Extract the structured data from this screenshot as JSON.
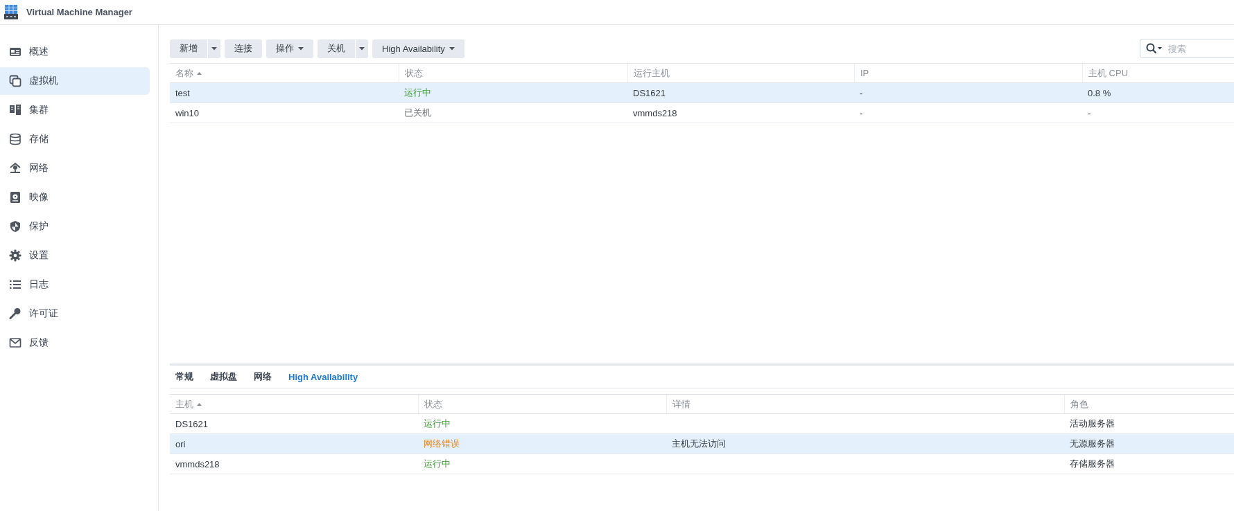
{
  "window": {
    "title": "Virtual Machine Manager"
  },
  "sidebar": {
    "items": [
      {
        "label": "概述",
        "selected": false
      },
      {
        "label": "虚拟机",
        "selected": true
      },
      {
        "label": "集群",
        "selected": false
      },
      {
        "label": "存储",
        "selected": false
      },
      {
        "label": "网络",
        "selected": false
      },
      {
        "label": "映像",
        "selected": false
      },
      {
        "label": "保护",
        "selected": false
      },
      {
        "label": "设置",
        "selected": false
      },
      {
        "label": "日志",
        "selected": false
      },
      {
        "label": "许可证",
        "selected": false
      },
      {
        "label": "反馈",
        "selected": false
      }
    ]
  },
  "toolbar": {
    "buttons": [
      {
        "label": "新增",
        "kind": "split"
      },
      {
        "label": "连接",
        "kind": "plain"
      },
      {
        "label": "操作",
        "kind": "menu"
      },
      {
        "label": "关机",
        "kind": "split"
      },
      {
        "label": "High Availability",
        "kind": "menu"
      }
    ],
    "search": {
      "placeholder": "搜索"
    }
  },
  "vm_table": {
    "columns": [
      {
        "label": "名称",
        "sorted": true
      },
      {
        "label": "状态",
        "sorted": false
      },
      {
        "label": "运行主机",
        "sorted": false
      },
      {
        "label": "IP",
        "sorted": false
      },
      {
        "label": "主机 CPU",
        "sorted": false
      }
    ],
    "rows": [
      {
        "selected": true,
        "name": "test",
        "status": {
          "text": "运行中",
          "kind": "running"
        },
        "host": "DS1621",
        "ip": "-",
        "cpu": "0.8 %"
      },
      {
        "selected": false,
        "name": "win10",
        "status": {
          "text": "已关机",
          "kind": "off"
        },
        "host": "vmmds218",
        "ip": "-",
        "cpu": "-"
      }
    ]
  },
  "detail_tabs": [
    {
      "label": "常规",
      "selected": false
    },
    {
      "label": "虚拟盘",
      "selected": false
    },
    {
      "label": "网络",
      "selected": false
    },
    {
      "label": "High Availability",
      "selected": true
    }
  ],
  "ha_table": {
    "columns": [
      {
        "label": "主机",
        "sorted": true
      },
      {
        "label": "状态",
        "sorted": false
      },
      {
        "label": "详情",
        "sorted": false
      },
      {
        "label": "角色",
        "sorted": false
      }
    ],
    "rows": [
      {
        "selected": false,
        "host": "DS1621",
        "status": {
          "text": "运行中",
          "kind": "running"
        },
        "role": "活动服务器"
      },
      {
        "selected": true,
        "host": "ori",
        "status": {
          "text": "网络错误",
          "kind": "error"
        },
        "details": "主机无法访问",
        "role": "无源服务器"
      },
      {
        "selected": false,
        "host": "vmmds218",
        "status": {
          "text": "运行中",
          "kind": "running"
        },
        "role": "存储服务器"
      }
    ]
  }
}
